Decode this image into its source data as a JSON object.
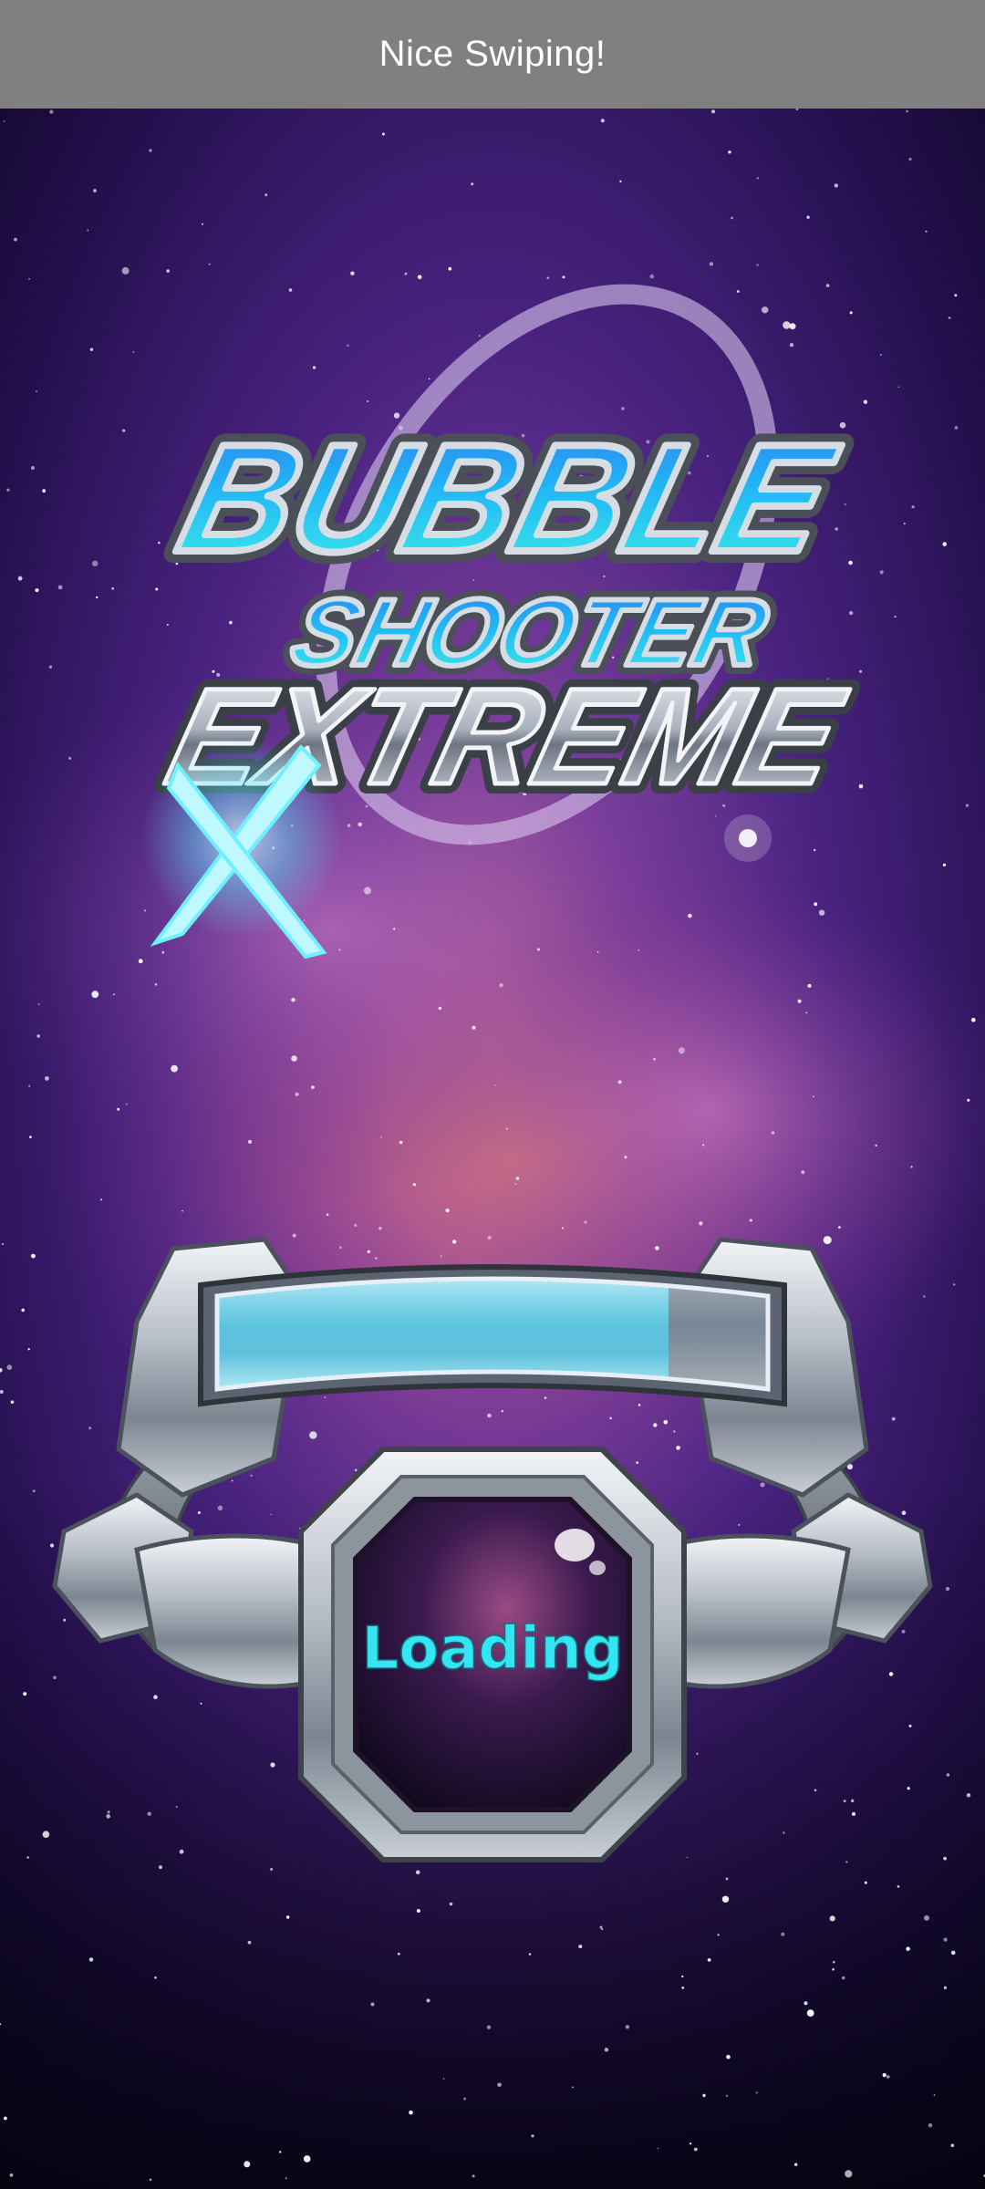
{
  "toast": {
    "message": "Nice Swiping!"
  },
  "game": {
    "logo_line1": "BUBBLE",
    "logo_line2": "SHOOTER",
    "logo_line3": "EXTREME",
    "loading_label": "Loading",
    "loading_progress": 0.82
  },
  "colors": {
    "toast_bg": "#808080",
    "accent_cyan": "#35e6f2",
    "space_purple": "#3b1a6e"
  },
  "icons": {
    "logo": "bubble-shooter-extreme-logo",
    "ring": "orbit-ring-icon",
    "loader_frame": "metal-loader-frame"
  }
}
